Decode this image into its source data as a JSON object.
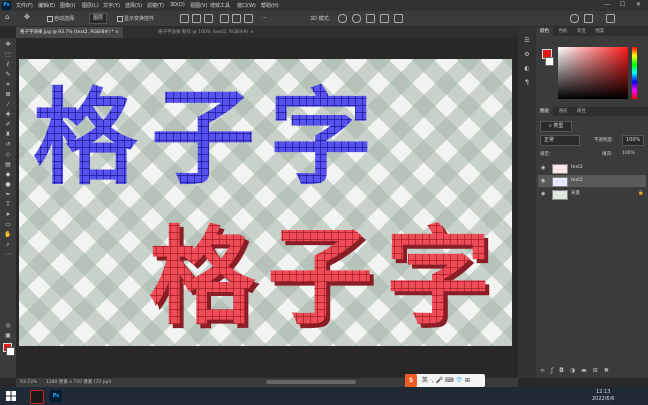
{
  "menubar": {
    "logo": "Ps",
    "items": [
      "文件(F)",
      "编辑(E)",
      "图像(I)",
      "图层(L)",
      "文字(Y)",
      "选择(S)",
      "滤镜(T)",
      "3D(D)",
      "视图(V)",
      "增效工具",
      "窗口(W)",
      "帮助(H)"
    ],
    "window_controls": [
      "—",
      "☐",
      "✕"
    ]
  },
  "options": {
    "auto_select_label": "自动选择:",
    "auto_select_value": "图层",
    "show_transform_label": "显示变换控件",
    "mode3d_label": "3D 模式:",
    "more": "···"
  },
  "tabs": [
    {
      "label": "格子字效果.jpg @ 93.7% (text2, RGB/8#) *  ×"
    },
    {
      "label": "格子字效果 制作 @ 100% (text2, RGB/8#)  ×"
    }
  ],
  "canvas": {
    "blue_text": "格子字",
    "red_text": "格子字",
    "blue_color": "#5852ee",
    "red_color": "#ee4d58"
  },
  "status": {
    "zoom": "93.73%",
    "doc_size": "1280 像素 x 720 像素 (72 ppi)"
  },
  "ime": {
    "logo": "S",
    "label": "英 ·, 🎤 ⌨ 👕 ⊞"
  },
  "color_panel": {
    "tabs": [
      "颜色",
      "色板",
      "渐变",
      "图案"
    ],
    "fg": "#e01919",
    "bg": "#ffffff"
  },
  "layers_panel": {
    "tabs": [
      "图层",
      "通道",
      "路径"
    ],
    "kind_label": "类型",
    "blend_mode": "正常",
    "opacity_label": "不透明度:",
    "opacity_value": "100%",
    "lock_label": "锁定:",
    "fill_label": "填充:",
    "fill_value": "100%",
    "layers": [
      {
        "name": "text2"
      },
      {
        "name": "text2"
      },
      {
        "name": "背景"
      }
    ]
  },
  "taskbar": {
    "time": "12:13",
    "date": "2022/6/6"
  }
}
